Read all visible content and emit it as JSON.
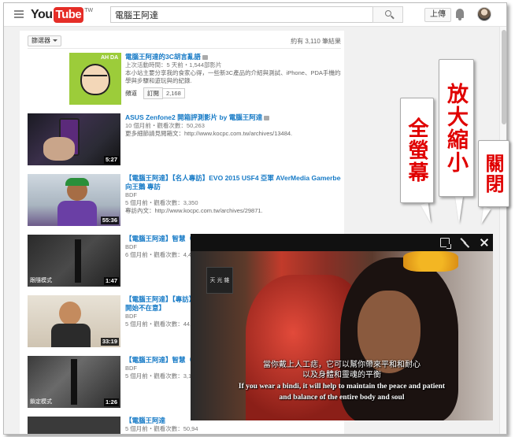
{
  "header": {
    "logo_you": "You",
    "logo_tube": "Tube",
    "logo_region": "TW",
    "search_value": "電腦王阿達",
    "upload_label": "上傳"
  },
  "results": {
    "filter_label": "篩選器",
    "count_text": "約有 3,110 筆結果",
    "channel": {
      "title": "電腦王阿達的3C胡言亂語",
      "thumb_text": "AH DA",
      "meta": "上次活動時間：5 天前・1,544部影片",
      "desc1": "本小站主要分享我的食家心得，一些新3C產品的介紹與測試、iPhone、PDA手機的教",
      "desc2": "學與步驟和遊玩與的紀錄.",
      "tab_label": "頻道",
      "subscribe_label": "訂閱",
      "subscriber_count": "2,168"
    },
    "videos": [
      {
        "title": "ASUS Zenfone2 開箱評測影片 by 電腦王阿達",
        "meta1": "10 個月前・觀看次數：50,263",
        "desc": "更多細節請見閱箱文：http://www.kocpc.com.tw/archives/13484.",
        "duration": "5:27"
      },
      {
        "title": "【電腦王阿達】【名人專訪】EVO 2015 USF4 亞軍 AVerMedia Gamerbee",
        "title2": "向王鵝 專訪",
        "channel": "BDF",
        "meta1": "5 個月前・觀看次數：3,350",
        "desc": "專訪內文：http://www.kocpc.com.tw/archives/29871.",
        "duration": "55:36"
      },
      {
        "title": "【電腦王阿達】智慧（Z",
        "channel": "BDF",
        "meta1": "6 個月前・觀看次數：4,45",
        "duration": "1:47",
        "thumb_text": "跟隨模式"
      },
      {
        "title": "【電腦王阿達】【專訪】",
        "title2": "開始不在意】",
        "channel": "BDF",
        "meta1": "5 個月前・觀看次數：44,4",
        "duration": "33:19"
      },
      {
        "title": "【電腦王阿達】智慧（Z",
        "channel": "BDF",
        "meta1": "5 個月前・觀看次數：3,10",
        "duration": "1:26",
        "thumb_text": "鎖定模式"
      },
      {
        "title": "【電腦王阿達",
        "meta1": "5 個月前・觀看次數：50,94"
      }
    ]
  },
  "player": {
    "channel_logo": "天 光 雜",
    "subtitle_zh1": "當你戴上人工痣，它可以幫你帶來平和和耐心",
    "subtitle_zh2": "以及身體和靈魂的平衡",
    "subtitle_en1": "If you wear a bindi, it will help to maintain the peace and patient",
    "subtitle_en2": "and balance of the entire body and soul"
  },
  "callouts": {
    "fullscreen": "全螢幕",
    "zoom": "放大縮小",
    "close": "關閉"
  },
  "colors": {
    "brand_red": "#e52d27",
    "link_blue": "#167ac6",
    "callout_red": "#e00000"
  }
}
